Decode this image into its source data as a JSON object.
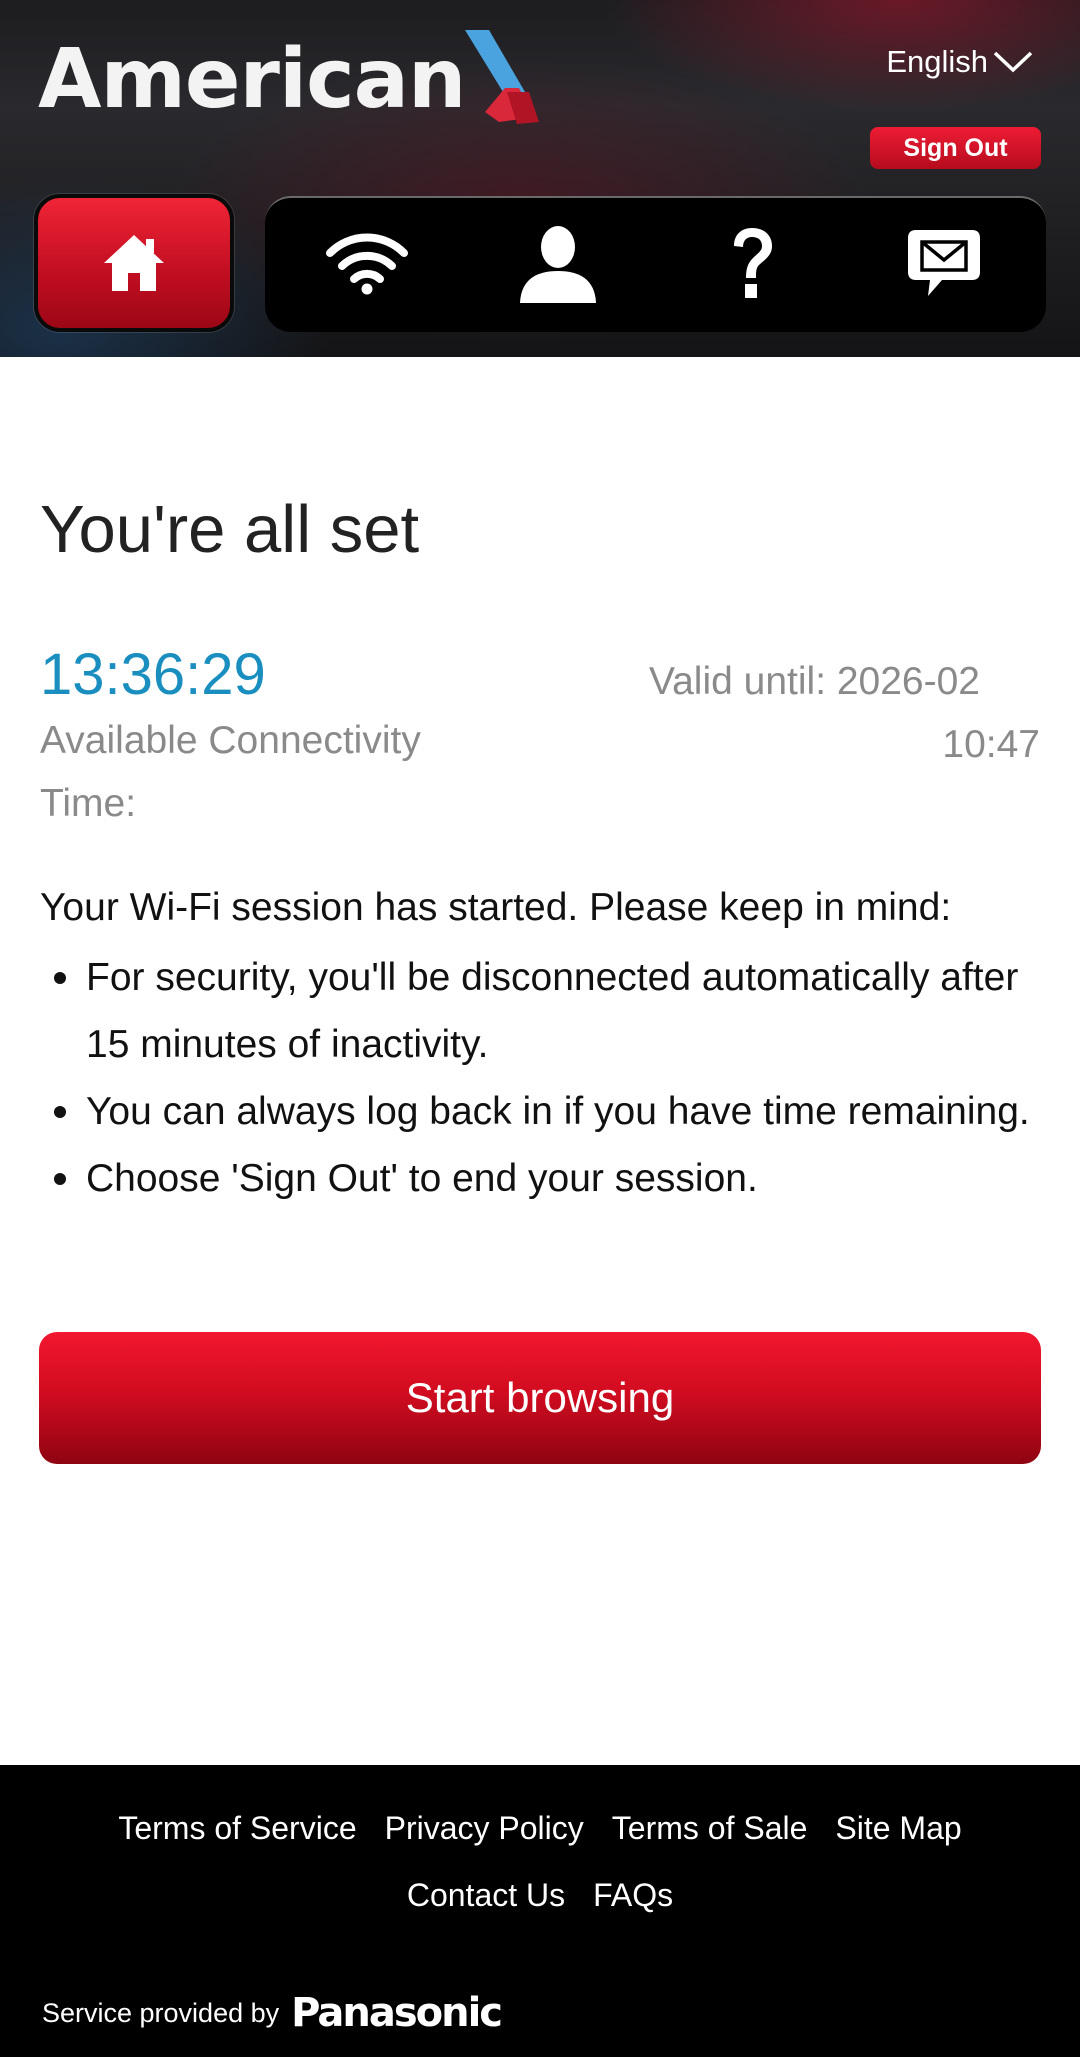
{
  "header": {
    "logo_text": "American",
    "language": "English",
    "sign_out_label": "Sign Out",
    "nav": [
      {
        "icon": "home-icon",
        "active": true
      },
      {
        "icon": "wifi-icon"
      },
      {
        "icon": "user-icon"
      },
      {
        "icon": "help-icon"
      },
      {
        "icon": "message-icon"
      }
    ]
  },
  "main": {
    "title": "You're all set",
    "timer": "13:36:29",
    "available_label": "Available Connectivity Time:",
    "valid_label": "Valid until: 2026-02",
    "valid_time": "10:47",
    "intro": "Your Wi-Fi session has started. Please keep in mind:",
    "bullets": [
      "For security, you'll be disconnected automatically after 15 minutes of inactivity.",
      "You can always log back in if you have time remaining.",
      "Choose 'Sign Out' to end your session."
    ],
    "start_button": "Start browsing"
  },
  "footer": {
    "links": [
      "Terms of Service",
      "Privacy Policy",
      "Terms of Sale",
      "Site Map",
      "Contact Us",
      "FAQs"
    ],
    "provided_by": "Service provided by",
    "provider": "Panasonic"
  },
  "colors": {
    "brand_red": "#d20c20",
    "timer_blue": "#1a8fbf",
    "muted_gray": "#8a8a8a"
  }
}
